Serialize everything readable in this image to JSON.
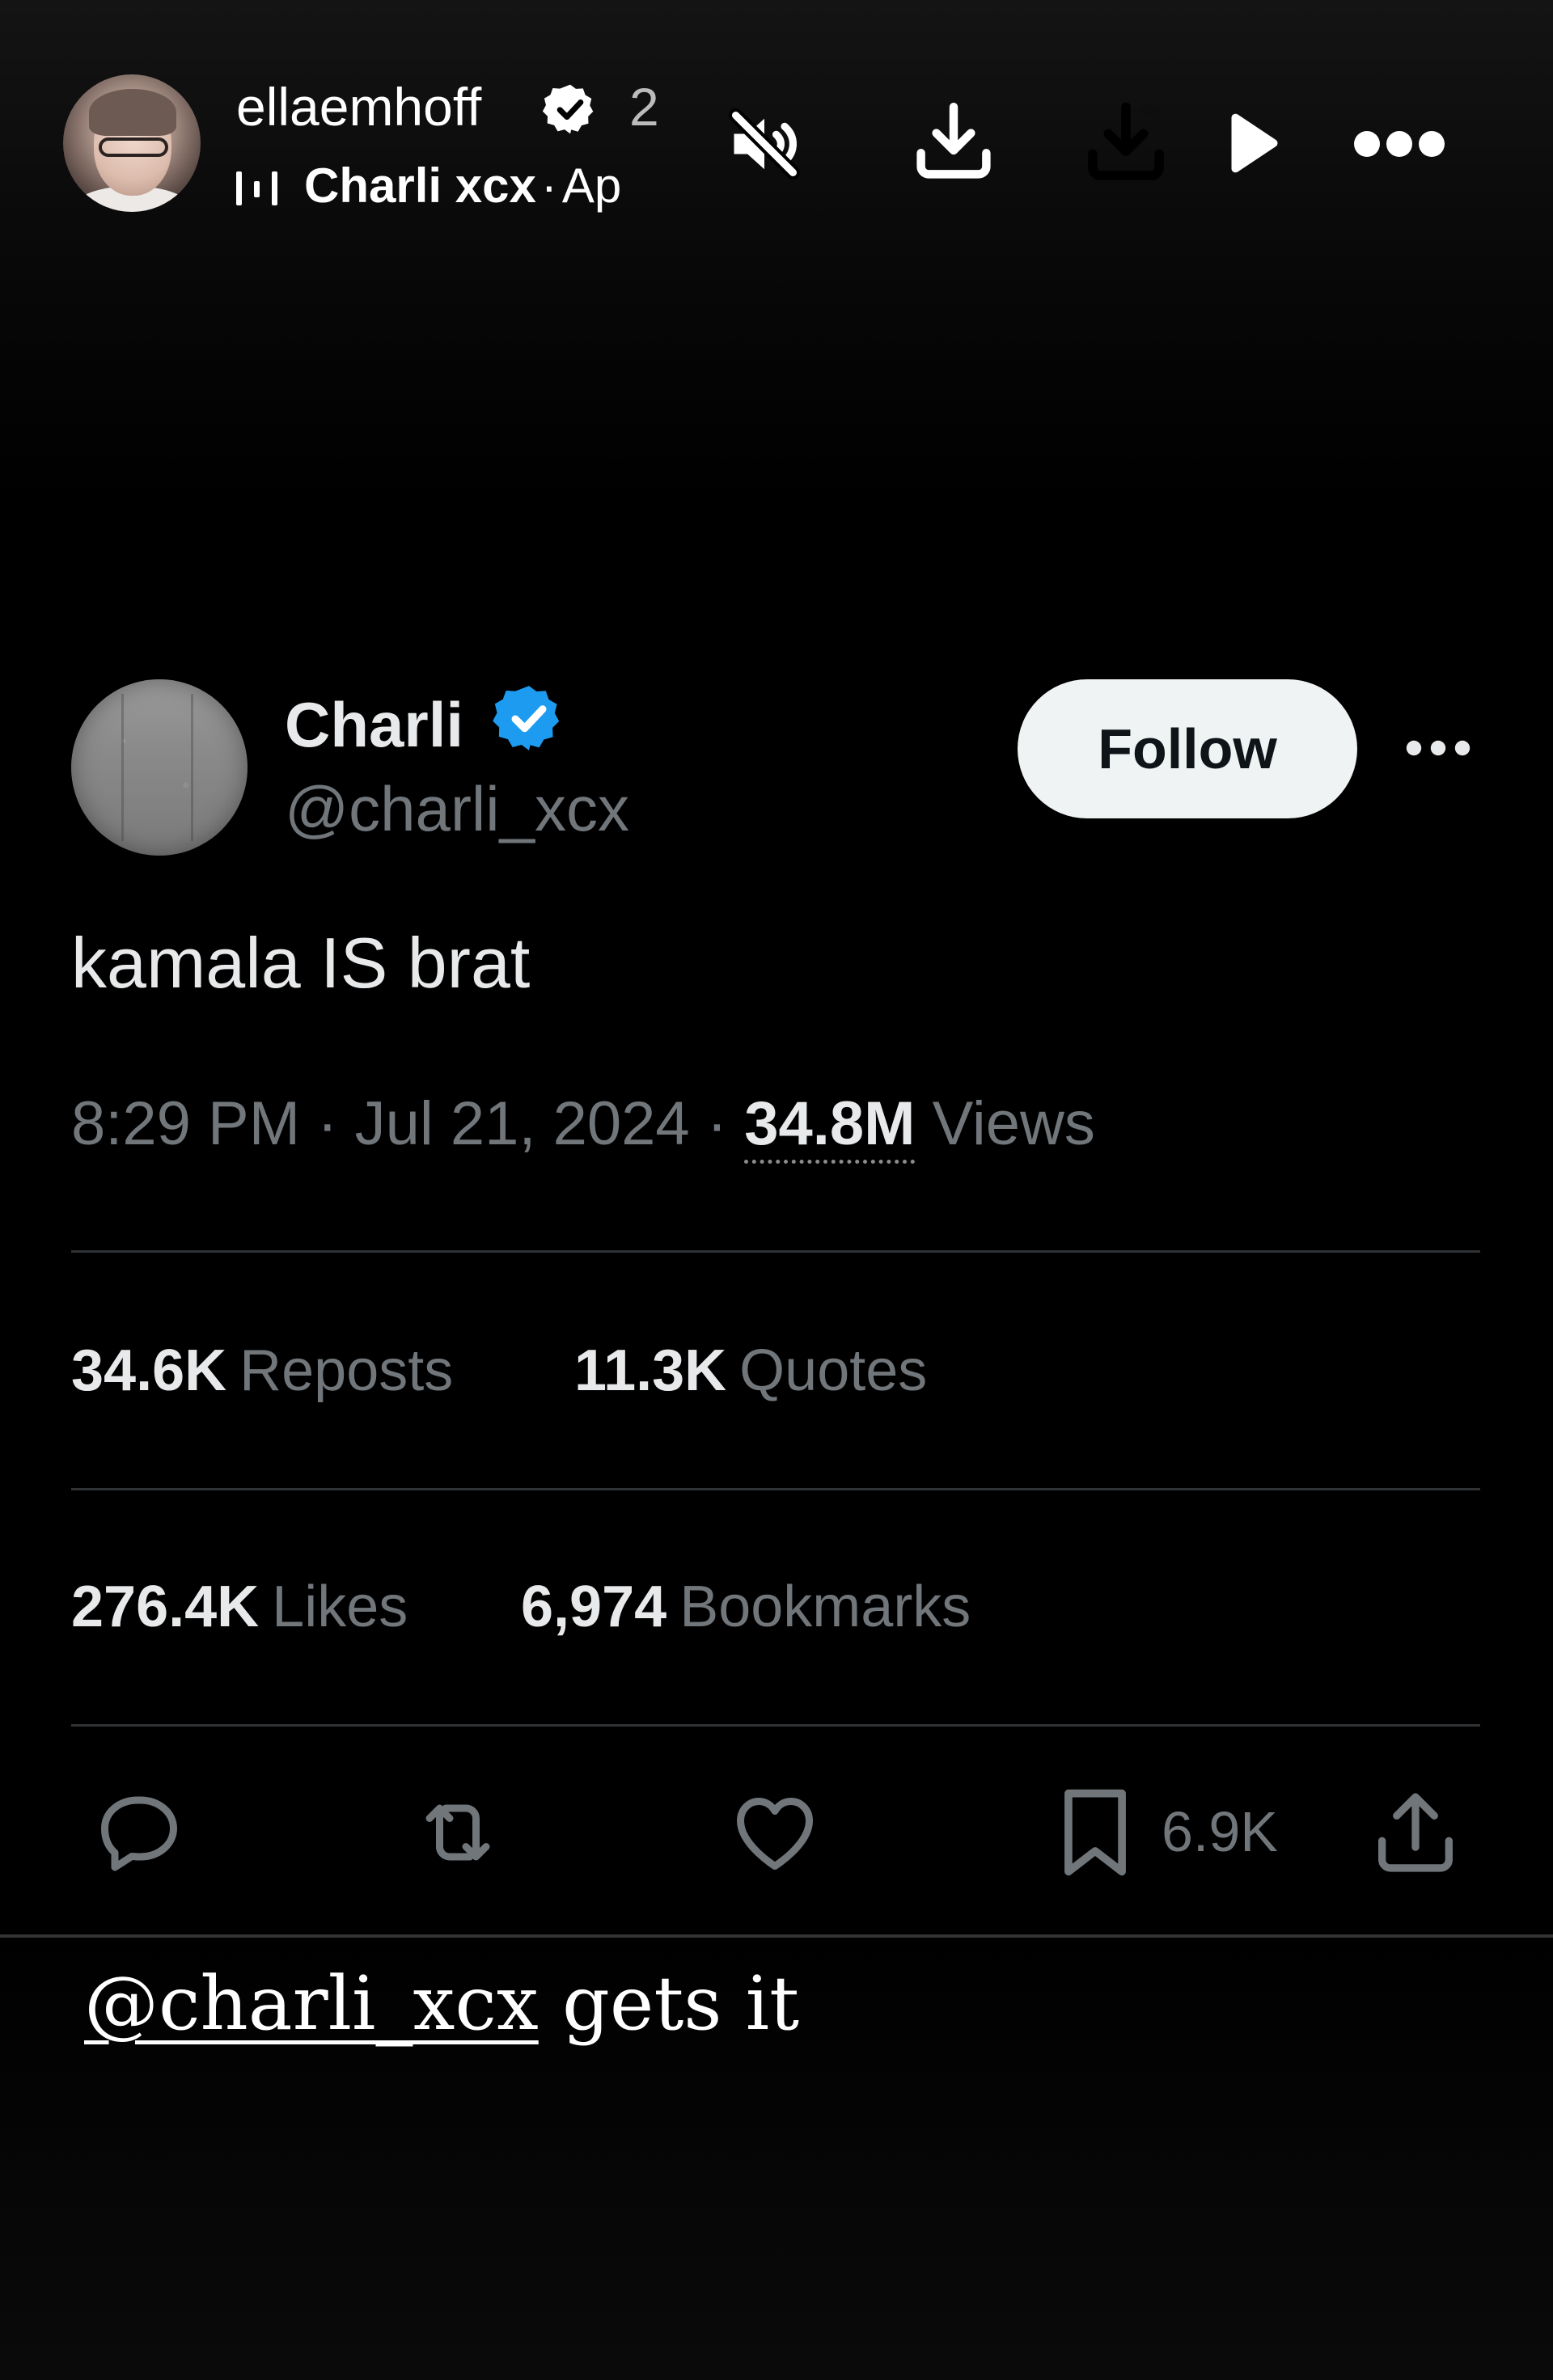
{
  "story": {
    "username": "ellaemhoff",
    "time_ago": "2",
    "music": {
      "artist": "Charli xcx",
      "separator": "·",
      "truncated_title": "Ap"
    },
    "icons": [
      "muted-speaker-icon",
      "download-icon",
      "save-to-device-icon",
      "play-icon",
      "more-options-icon"
    ]
  },
  "tweet": {
    "display_name": "Charli",
    "handle": "@charli_xcx",
    "follow_label": "Follow",
    "text": "kamala IS brat",
    "timestamp": "8:29 PM · Jul 21, 2024 · ",
    "views_count": "34.8M",
    "views_label": "Views",
    "stats": {
      "reposts_count": "34.6K",
      "reposts_label": "Reposts",
      "quotes_count": "11.3K",
      "quotes_label": "Quotes",
      "likes_count": "276.4K",
      "likes_label": "Likes",
      "bookmarks_count": "6,974",
      "bookmarks_label": "Bookmarks"
    },
    "actions": {
      "bookmark_count": "6.9K"
    },
    "colors": {
      "verified_blue": "#1d9bf0",
      "text_primary": "#e7e9ea",
      "text_secondary": "#71767b",
      "divider": "#2f3336"
    }
  },
  "caption": {
    "mention": "@charli_xcx",
    "text": " gets it"
  }
}
